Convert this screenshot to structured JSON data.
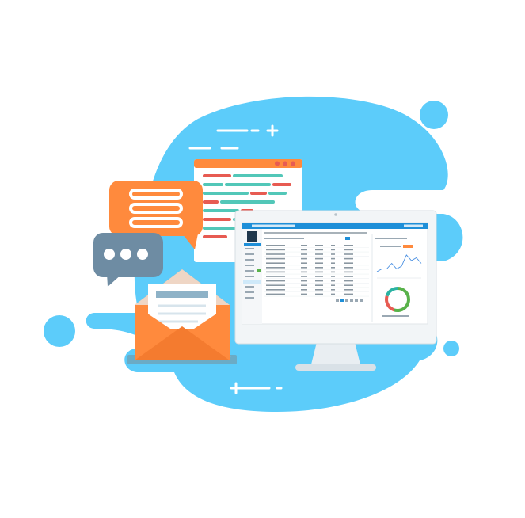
{
  "illustration": {
    "theme": "web dashboard and messaging",
    "colors": {
      "blob": "#5CCCFA",
      "orange": "#FF8A3D",
      "slate": "#6E8CA3",
      "teal_accent": "#52C7B8",
      "red_accent": "#E75B52",
      "monitor_frame": "#F2F5F7",
      "monitor_stand": "#E9EEF2",
      "screen_header": "#1E8FD8",
      "chart_line": "#4A90E2",
      "donut_green": "#59B24A",
      "donut_red": "#E75B52",
      "donut_teal": "#2BB3A3"
    },
    "icons": [
      "chat-bubble-icon",
      "typing-bubble-icon",
      "envelope-icon",
      "code-window-icon",
      "monitor-icon",
      "plus-icon"
    ],
    "dashboard": {
      "table_rows": 12,
      "line_chart": [
        2,
        3,
        3,
        5,
        3,
        4,
        8,
        6,
        7,
        5
      ],
      "donut_segments": [
        0.55,
        0.25,
        0.2
      ]
    }
  }
}
